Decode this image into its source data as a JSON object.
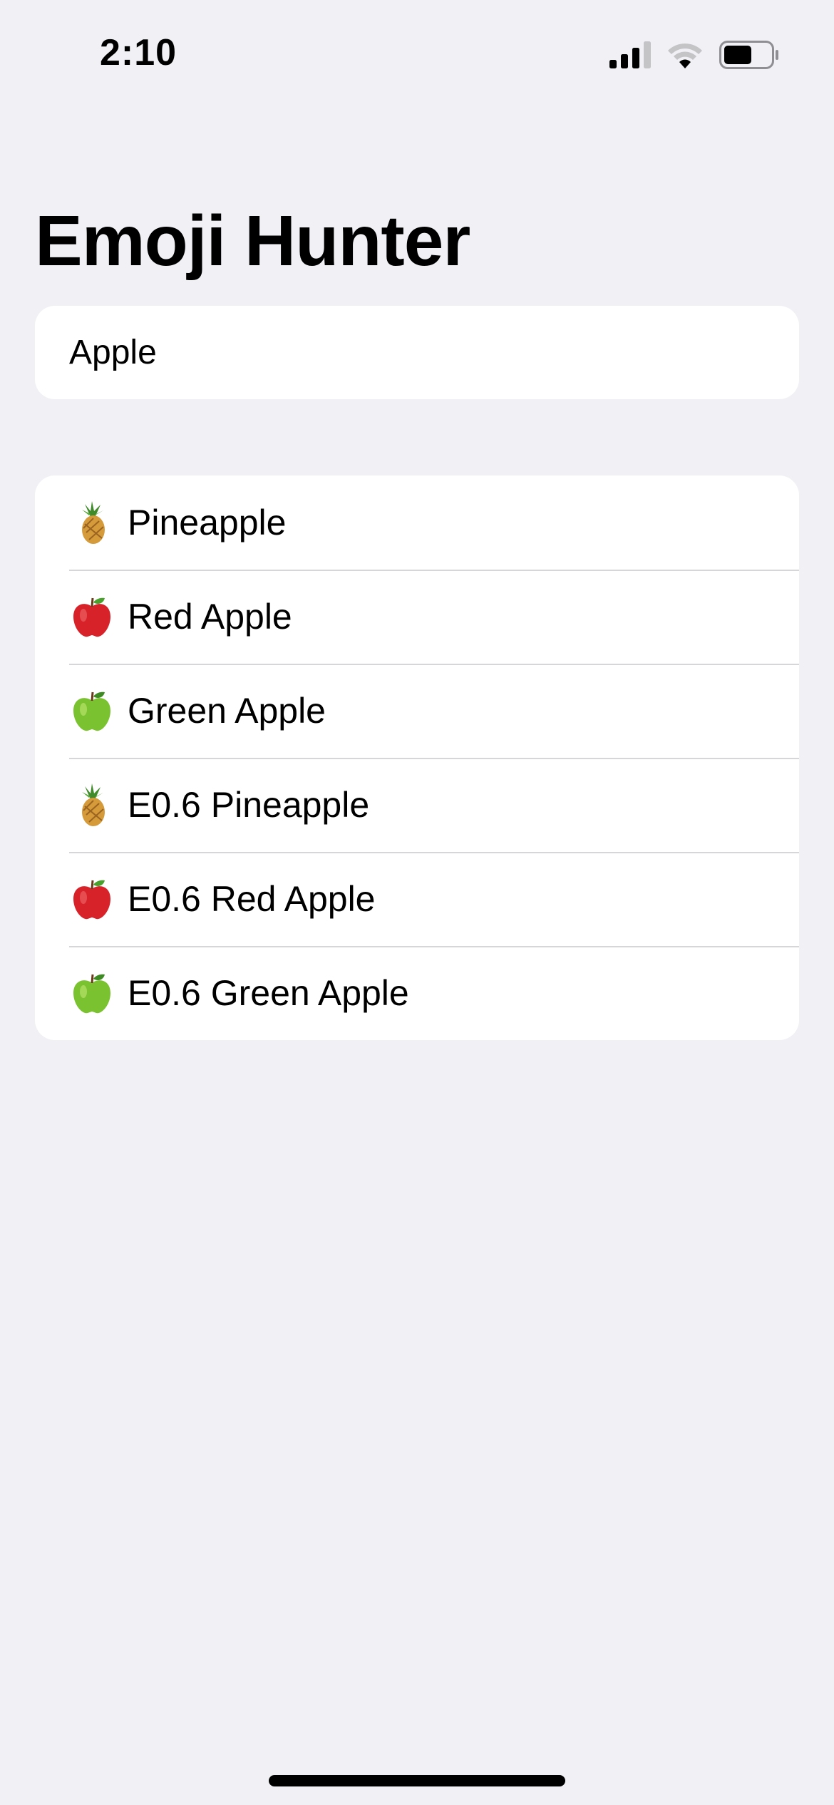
{
  "status_bar": {
    "time": "2:10",
    "icons": [
      "cellular-signal-icon",
      "wifi-icon",
      "battery-icon"
    ]
  },
  "title": "Emoji Hunter",
  "search": {
    "value": "Apple",
    "placeholder": ""
  },
  "results": [
    {
      "emoji": "pineapple",
      "label": "Pineapple"
    },
    {
      "emoji": "red-apple",
      "label": "Red Apple"
    },
    {
      "emoji": "green-apple",
      "label": "Green Apple"
    },
    {
      "emoji": "pineapple",
      "label": "E0.6 Pineapple"
    },
    {
      "emoji": "red-apple",
      "label": "E0.6 Red Apple"
    },
    {
      "emoji": "green-apple",
      "label": "E0.6 Green Apple"
    }
  ],
  "colors": {
    "background": "#f1f0f5",
    "card": "#ffffff",
    "separator": "#d6d6da",
    "text": "#000000"
  }
}
